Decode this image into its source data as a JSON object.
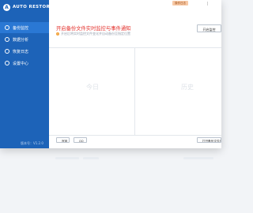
{
  "app": {
    "logo_glyph": "A",
    "name": "AUTO RESTORE",
    "version": "版本号：V1.2.0"
  },
  "sidebar": {
    "items": [
      {
        "label": "备份监控",
        "icon": "monitor-icon",
        "active": true
      },
      {
        "label": "数据分析",
        "icon": "chart-icon",
        "active": false
      },
      {
        "label": "恢复日志",
        "icon": "log-icon",
        "active": false
      },
      {
        "label": "设置中心",
        "icon": "gear-icon",
        "active": false
      }
    ]
  },
  "topbar": {
    "tag": "操作日志"
  },
  "banner": {
    "title": "开启备份文件实时监控与事件通知",
    "subtitle": "开启后将实时监控文件变化并自动备份至指定位置",
    "info_icon": "!",
    "start_button": "开启监控"
  },
  "panels": {
    "today": "今日",
    "history": "历史"
  },
  "footer": {
    "button_1": "官网",
    "button_2": "QQ",
    "open_button": "打开备份文件夹"
  },
  "colors": {
    "sidebar": "#1d63b8",
    "sidebar_active": "#2a78d4",
    "accent_red": "#e3302b"
  }
}
